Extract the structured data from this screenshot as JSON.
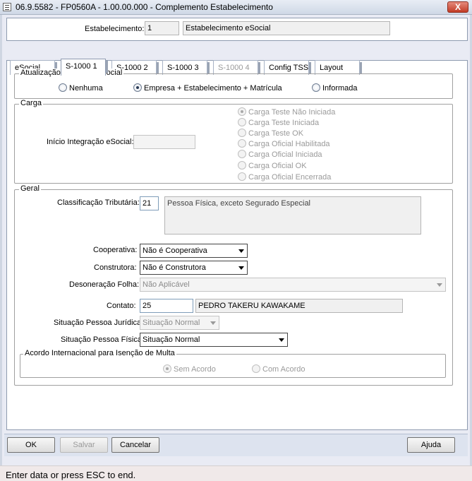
{
  "window": {
    "title": "06.9.5582 - FP0560A - 1.00.00.000 - Complemento Estabelecimento",
    "close_label": "X"
  },
  "header": {
    "estab_label": "Estabelecimento:",
    "estab_code": "1",
    "estab_name": "Estabelecimento eSocial"
  },
  "tabs": [
    {
      "label": "eSocial"
    },
    {
      "label": "S-1000 1"
    },
    {
      "label": "S-1000 2"
    },
    {
      "label": "S-1000 3"
    },
    {
      "label": "S-1000 4"
    },
    {
      "label": "Config TSS"
    },
    {
      "label": "Layout"
    }
  ],
  "atualizacao": {
    "legend": "Atualização Matrícula eSocial",
    "options": [
      {
        "label": "Nenhuma"
      },
      {
        "label": "Empresa + Estabelecimento + Matrícula"
      },
      {
        "label": "Informada"
      }
    ]
  },
  "carga": {
    "legend": "Carga",
    "inicio_label": "Início Integração eSocial:",
    "inicio_value": "",
    "options": [
      {
        "label": "Carga Teste Não Iniciada"
      },
      {
        "label": "Carga Teste Iniciada"
      },
      {
        "label": "Carga Teste OK"
      },
      {
        "label": "Carga Oficial Habilitada"
      },
      {
        "label": "Carga Oficial Iniciada"
      },
      {
        "label": "Carga Oficial OK"
      },
      {
        "label": "Carga Oficial Encerrada"
      }
    ]
  },
  "geral": {
    "legend": "Geral",
    "classificacao_label": "Classificação Tributária:",
    "classificacao_code": "21",
    "classificacao_desc": "Pessoa Física, exceto Segurado Especial",
    "cooperativa_label": "Cooperativa:",
    "cooperativa_value": "Não é Cooperativa",
    "construtora_label": "Construtora:",
    "construtora_value": "Não é Construtora",
    "desoneracao_label": "Desoneração Folha:",
    "desoneracao_value": "Não Aplicável",
    "contato_label": "Contato:",
    "contato_code": "25",
    "contato_name": "PEDRO TAKERU KAWAKAME",
    "sit_pj_label": "Situação Pessoa Jurídica:",
    "sit_pj_value": "Situação Normal",
    "sit_pf_label": "Situação Pessoa Física:",
    "sit_pf_value": "Situação Normal",
    "acordo": {
      "legend": "Acordo Internacional para Isenção de Multa",
      "options": [
        {
          "label": "Sem Acordo"
        },
        {
          "label": "Com Acordo"
        }
      ]
    }
  },
  "buttons": {
    "ok": "OK",
    "salvar": "Salvar",
    "cancelar": "Cancelar",
    "ajuda": "Ajuda"
  },
  "status": "Enter data or press ESC to end."
}
